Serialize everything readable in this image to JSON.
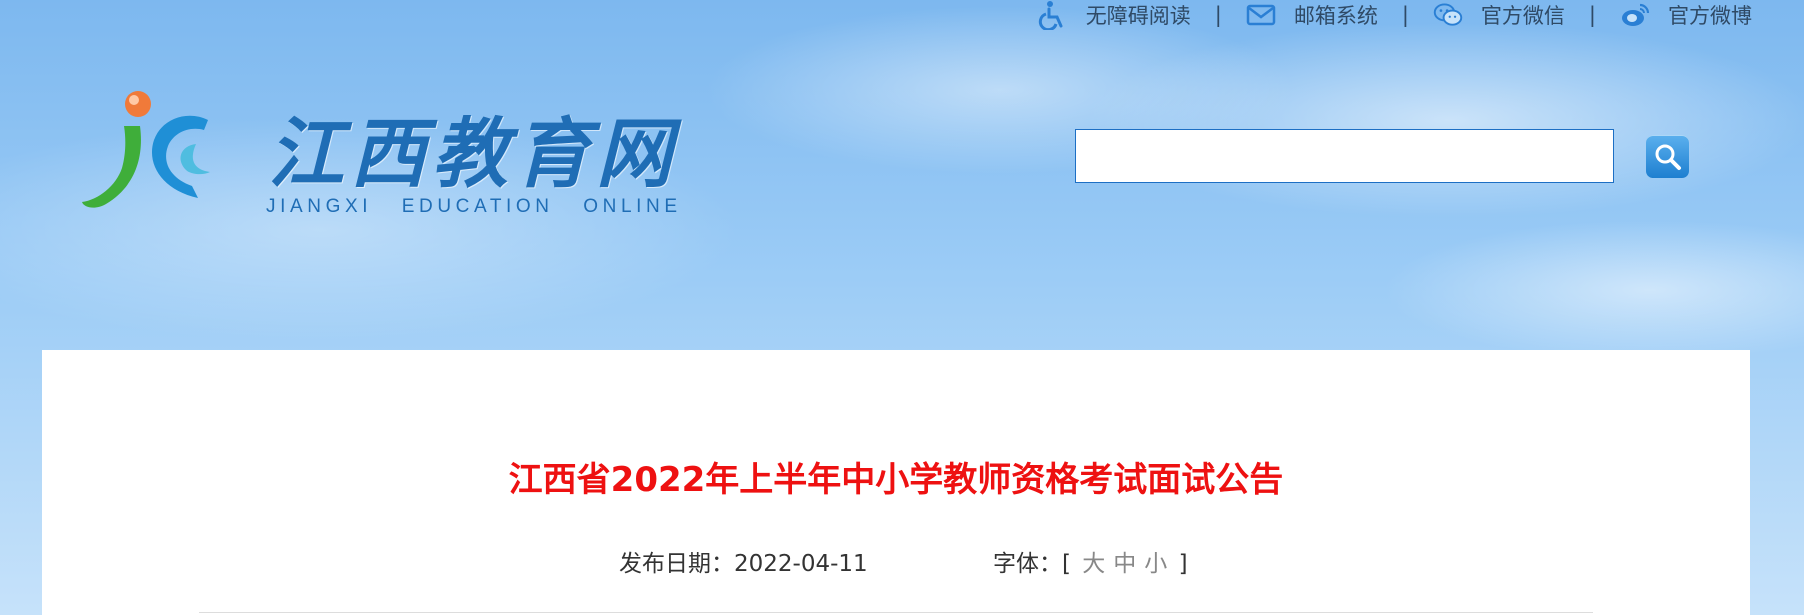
{
  "top_links": [
    {
      "label": "无障碍阅读",
      "icon": "accessibility-icon"
    },
    {
      "label": "邮箱系统",
      "icon": "mail-icon"
    },
    {
      "label": "官方微信",
      "icon": "wechat-icon"
    },
    {
      "label": "官方微博",
      "icon": "weibo-icon"
    }
  ],
  "separator": "|",
  "logo": {
    "title": "江西教育网",
    "subtitle": "JIANGXI   EDUCATION   ONLINE"
  },
  "search": {
    "value": "",
    "placeholder": ""
  },
  "article": {
    "title": "江西省2022年上半年中小学教师资格考试面试公告",
    "publish_label": "发布日期：",
    "publish_date": "2022-04-11",
    "font_label": "字体：",
    "bracket_open": "[",
    "bracket_close": "]",
    "font_sizes": [
      "大",
      "中",
      "小"
    ]
  },
  "colors": {
    "title_red": "#ee1111",
    "brand_blue": "#1f6db5",
    "search_border": "#1d6fc4"
  }
}
